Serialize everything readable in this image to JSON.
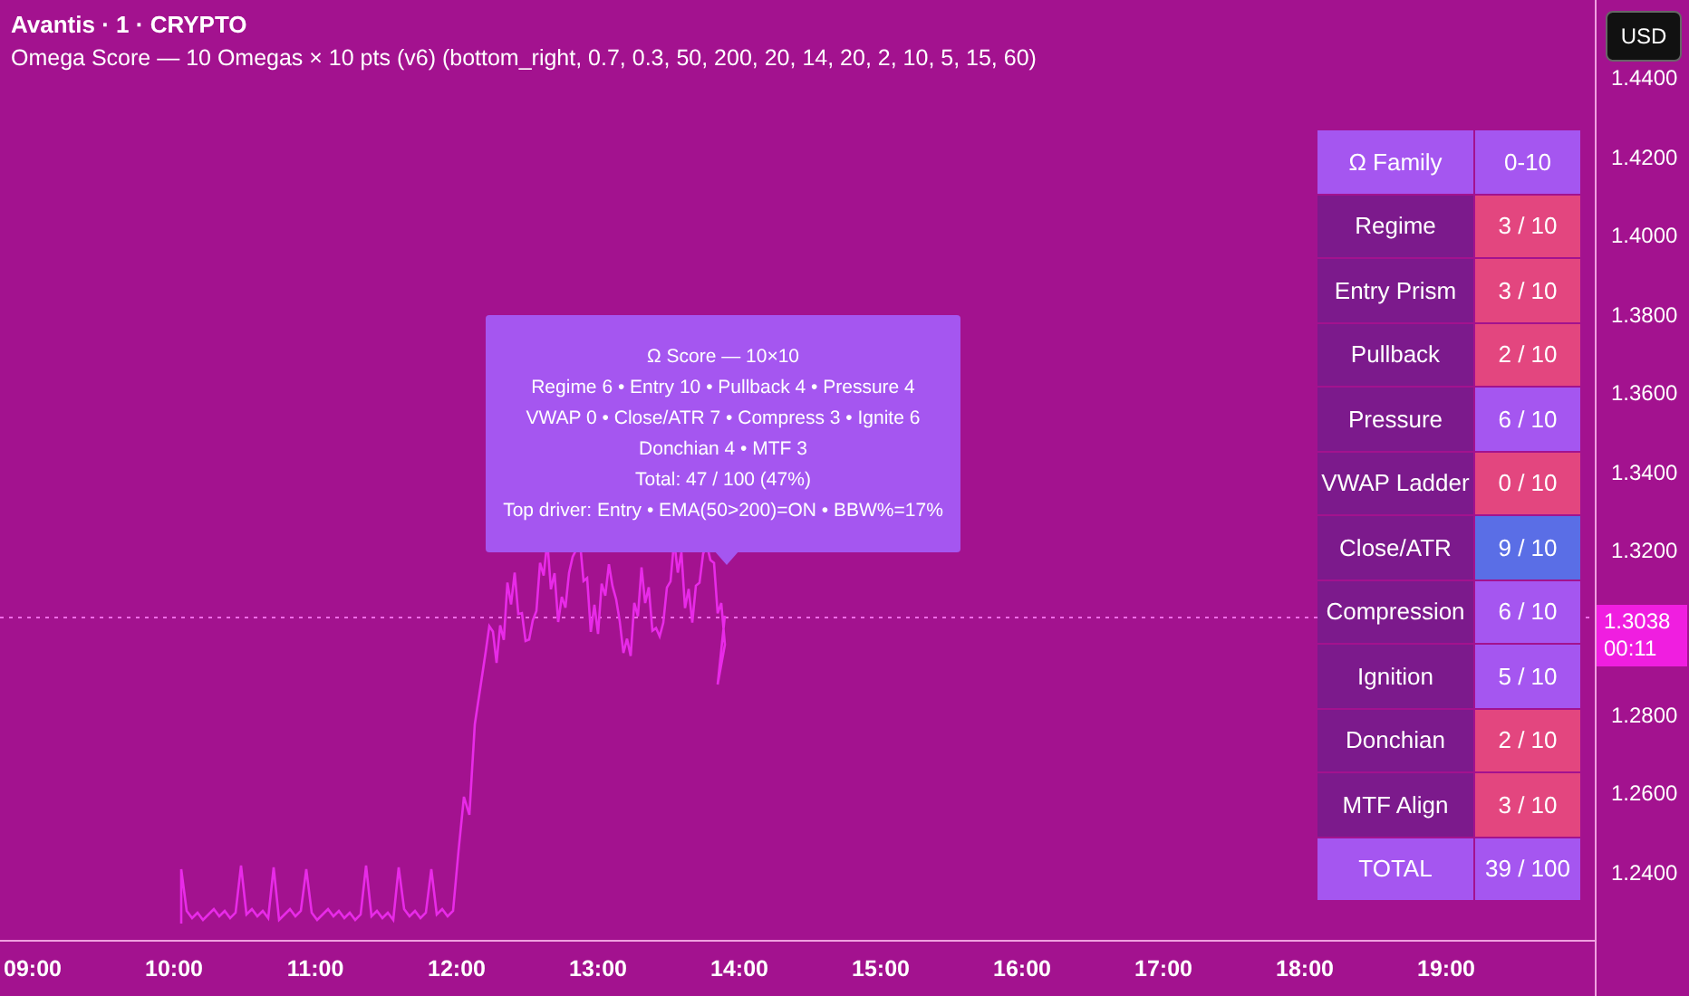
{
  "header": {
    "symbol": "Avantis · 1 · CRYPTO",
    "indicator": "Omega Score — 10 Omegas × 10 pts (v6) (bottom_right, 0.7, 0.3, 50, 200, 20, 14, 20, 2, 10, 5, 15, 60)"
  },
  "tooltip": {
    "lines": [
      "Ω Score — 10×10",
      "Regime 6 • Entry 10 • Pullback 4 • Pressure 4",
      "VWAP 0 • Close/ATR 7 • Compress 3 • Ignite 6",
      "Donchian 4 • MTF 3",
      "Total: 47 / 100  (47%)",
      "Top driver: Entry • EMA(50>200)=ON • BBW%=17%"
    ]
  },
  "score_table": {
    "header": {
      "label": "Ω Family",
      "value": "0-10"
    },
    "rows": [
      {
        "label": "Regime",
        "value": "3 / 10",
        "color": "#e3467f"
      },
      {
        "label": "Entry Prism",
        "value": "3 / 10",
        "color": "#e3467f"
      },
      {
        "label": "Pullback",
        "value": "2 / 10",
        "color": "#e3467f"
      },
      {
        "label": "Pressure",
        "value": "6 / 10",
        "color": "#a556f0"
      },
      {
        "label": "VWAP Ladder",
        "value": "0 / 10",
        "color": "#e3467f"
      },
      {
        "label": "Close/ATR",
        "value": "9 / 10",
        "color": "#5a6ee6"
      },
      {
        "label": "Compression",
        "value": "6 / 10",
        "color": "#a556f0"
      },
      {
        "label": "Ignition",
        "value": "5 / 10",
        "color": "#a556f0"
      },
      {
        "label": "Donchian",
        "value": "2 / 10",
        "color": "#e3467f"
      },
      {
        "label": "MTF Align",
        "value": "3 / 10",
        "color": "#e3467f"
      }
    ],
    "total": {
      "label": "TOTAL",
      "value": "39 / 100"
    }
  },
  "price_axis": {
    "currency_button": "USD",
    "upper_ticks": [
      "1.4400",
      "1.4200",
      "1.4000",
      "1.3800",
      "1.3600",
      "1.3400",
      "1.3200"
    ],
    "current_price": "1.3038",
    "countdown": "00:11",
    "lower_ticks": [
      "1.2800",
      "1.2600",
      "1.2400"
    ]
  },
  "time_axis": [
    "09:00",
    "10:00",
    "11:00",
    "12:00",
    "13:00",
    "14:00",
    "15:00",
    "16:00",
    "17:00",
    "18:00",
    "19:00"
  ]
}
